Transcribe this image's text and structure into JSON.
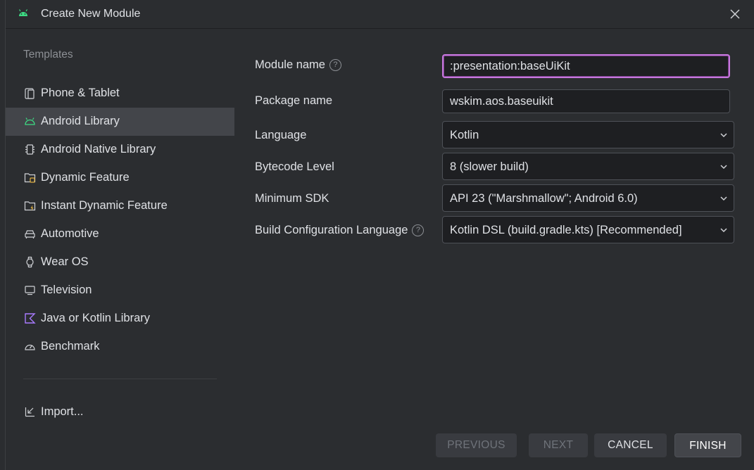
{
  "window": {
    "title": "Create New Module",
    "icon": "android-icon",
    "close_icon": "close-icon"
  },
  "sidebar": {
    "header": "Templates",
    "items": [
      {
        "label": "Phone & Tablet",
        "icon": "phone-tablet-icon",
        "selected": false
      },
      {
        "label": "Android Library",
        "icon": "android-icon",
        "selected": true
      },
      {
        "label": "Android Native Library",
        "icon": "chip-icon",
        "selected": false
      },
      {
        "label": "Dynamic Feature",
        "icon": "dynamic-feature-icon",
        "selected": false
      },
      {
        "label": "Instant Dynamic Feature",
        "icon": "instant-dynamic-feature-icon",
        "selected": false
      },
      {
        "label": "Automotive",
        "icon": "car-icon",
        "selected": false
      },
      {
        "label": "Wear OS",
        "icon": "watch-icon",
        "selected": false
      },
      {
        "label": "Television",
        "icon": "tv-icon",
        "selected": false
      },
      {
        "label": "Java or Kotlin Library",
        "icon": "kotlin-icon",
        "selected": false
      },
      {
        "label": "Benchmark",
        "icon": "gauge-icon",
        "selected": false
      }
    ],
    "import_label": "Import..."
  },
  "form": {
    "module_name": {
      "label": "Module name",
      "value": ":presentation:baseUiKit"
    },
    "package_name": {
      "label": "Package name",
      "value": "wskim.aos.baseuikit"
    },
    "language": {
      "label": "Language",
      "value": "Kotlin"
    },
    "bytecode_level": {
      "label": "Bytecode Level",
      "value": "8 (slower build)"
    },
    "minimum_sdk": {
      "label": "Minimum SDK",
      "value": "API 23 (\"Marshmallow\"; Android 6.0)"
    },
    "build_config_language": {
      "label": "Build Configuration Language",
      "value": "Kotlin DSL (build.gradle.kts) [Recommended]"
    }
  },
  "footer": {
    "previous": "PREVIOUS",
    "next": "NEXT",
    "cancel": "CANCEL",
    "finish": "FINISH"
  },
  "colors": {
    "accent_focus": "#c678dd",
    "android_green": "#3ddc84",
    "background": "#2b2d30"
  }
}
